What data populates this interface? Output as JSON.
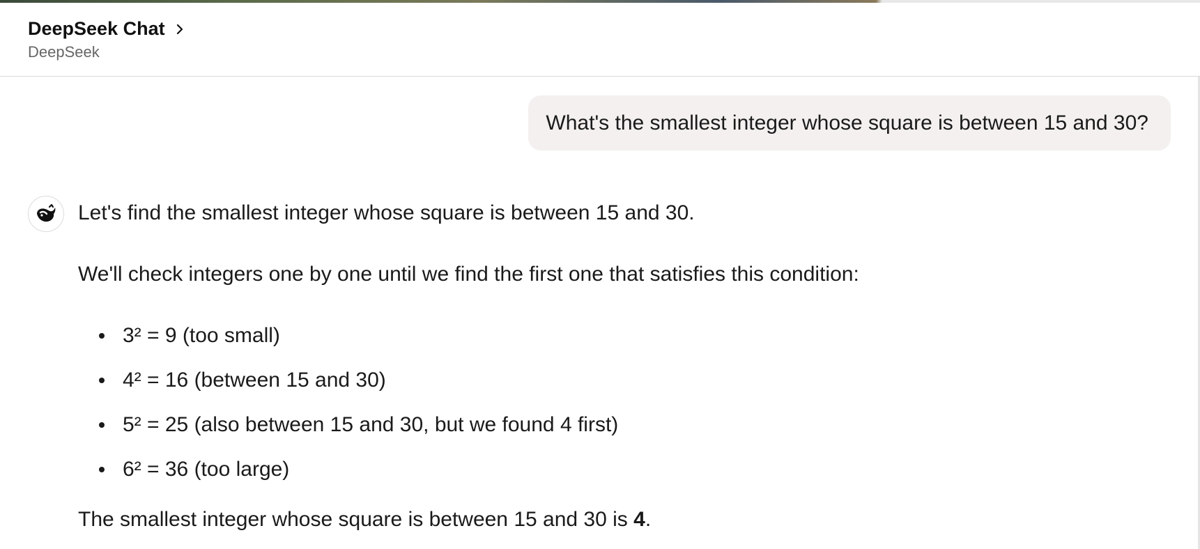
{
  "header": {
    "title": "DeepSeek Chat",
    "subtitle": "DeepSeek"
  },
  "conversation": {
    "user_message": "What's the smallest integer whose square is between 15 and 30?",
    "assistant": {
      "avatar_icon": "whale-icon",
      "intro": "Let's find the smallest integer whose square is between 15 and 30.",
      "method": "We'll check integers one by one until we find the first one that satisfies this condition:",
      "steps": [
        "3² = 9 (too small)",
        "4² = 16 (between 15 and 30)",
        "5² = 25 (also between 15 and 30, but we found 4 first)",
        "6² = 36 (too large)"
      ],
      "conclusion_prefix": "The smallest integer whose square is between 15 and 30 is ",
      "conclusion_answer": "4",
      "conclusion_suffix": "."
    }
  },
  "colors": {
    "user_bubble": "#f3f0ef",
    "text": "#1a1a1a",
    "subtitle": "#666666"
  }
}
